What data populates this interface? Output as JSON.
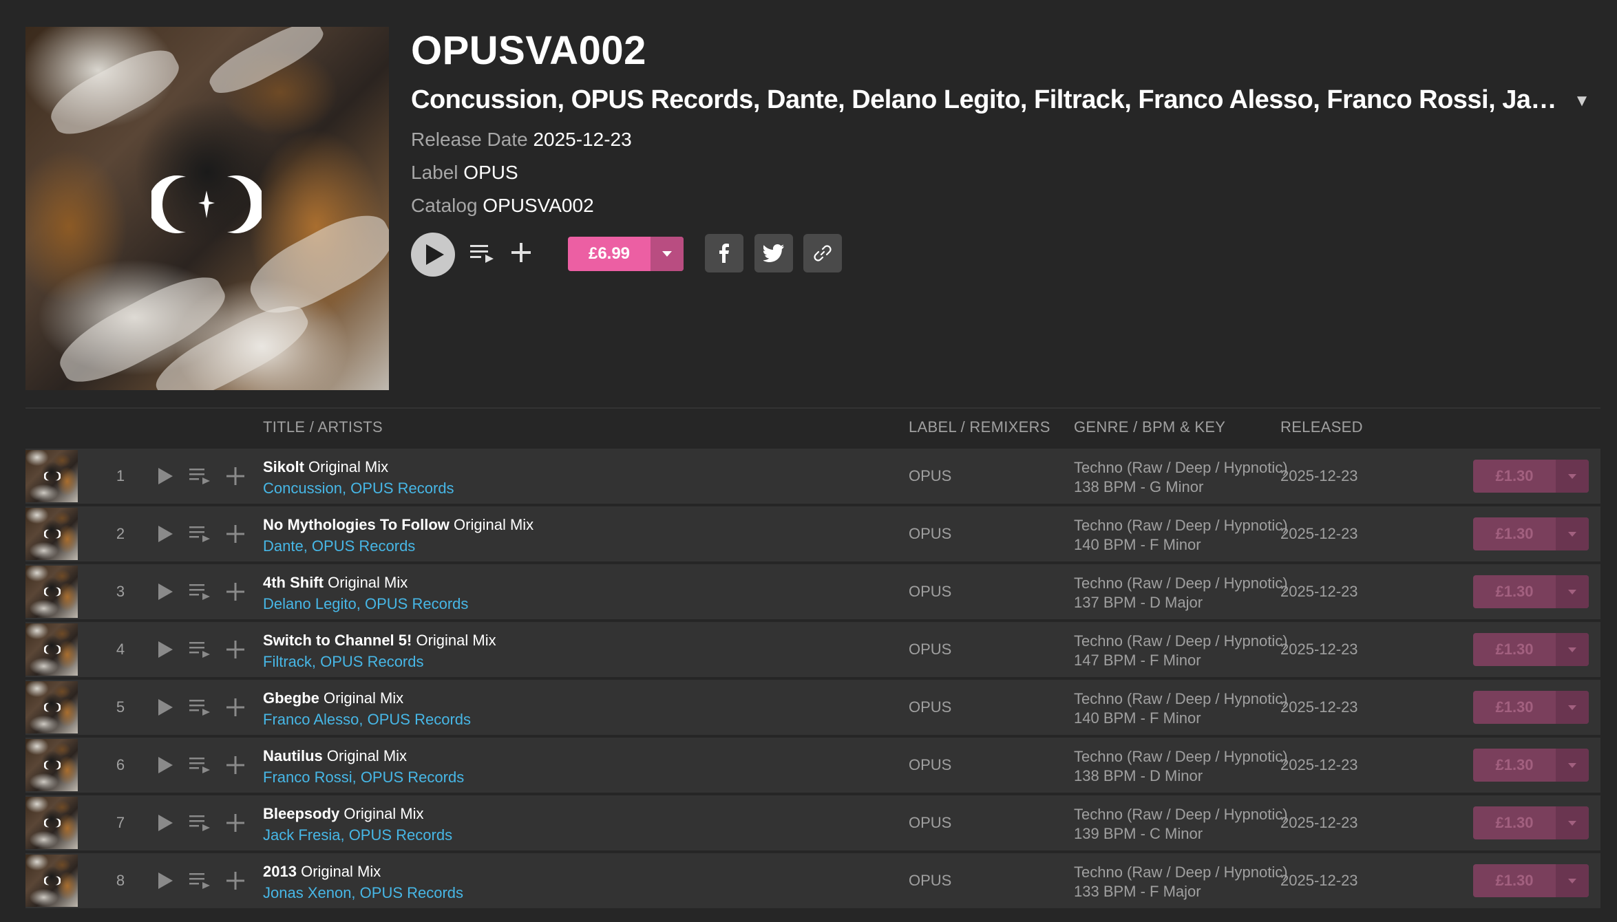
{
  "release": {
    "title": "OPUSVA002",
    "artists": "Concussion, OPUS Records, Dante, Delano Legito, Filtrack, Franco Alesso, Franco Rossi, Jack ...",
    "release_date_key": "Release Date",
    "release_date": "2025-12-23",
    "label_key": "Label",
    "label": "OPUS",
    "catalog_key": "Catalog",
    "catalog": "OPUSVA002",
    "price": "£6.99"
  },
  "colors": {
    "background": "#262626",
    "row_background": "#333333",
    "price_accent": "#ec5fa3",
    "artist_link": "#47b7e6",
    "muted_text": "#a0a0a0"
  },
  "icons": {
    "play": "play-icon",
    "queue": "add-to-queue-icon",
    "add": "plus-icon",
    "dropdown": "chevron-down-icon",
    "facebook": "facebook-icon",
    "twitter": "twitter-icon",
    "link": "link-icon"
  },
  "table": {
    "headers": {
      "title": "TITLE / ARTISTS",
      "label": "LABEL / REMIXERS",
      "genre": "GENRE / BPM & KEY",
      "released": "RELEASED"
    },
    "rows": [
      {
        "num": "1",
        "name": "Sikolt",
        "mix": "Original Mix",
        "artists": "Concussion, OPUS Records",
        "label": "OPUS",
        "genre": "Techno (Raw / Deep / Hypnotic)",
        "bpm_key": "138 BPM - G Minor",
        "released": "2025-12-23",
        "price": "£1.30"
      },
      {
        "num": "2",
        "name": "No Mythologies To Follow",
        "mix": "Original Mix",
        "artists": "Dante, OPUS Records",
        "label": "OPUS",
        "genre": "Techno (Raw / Deep / Hypnotic)",
        "bpm_key": "140 BPM - F Minor",
        "released": "2025-12-23",
        "price": "£1.30"
      },
      {
        "num": "3",
        "name": "4th Shift",
        "mix": "Original Mix",
        "artists": "Delano Legito, OPUS Records",
        "label": "OPUS",
        "genre": "Techno (Raw / Deep / Hypnotic)",
        "bpm_key": "137 BPM - D Major",
        "released": "2025-12-23",
        "price": "£1.30"
      },
      {
        "num": "4",
        "name": "Switch to Channel 5!",
        "mix": "Original Mix",
        "artists": "Filtrack, OPUS Records",
        "label": "OPUS",
        "genre": "Techno (Raw / Deep / Hypnotic)",
        "bpm_key": "147 BPM - F Minor",
        "released": "2025-12-23",
        "price": "£1.30"
      },
      {
        "num": "5",
        "name": "Gbegbe",
        "mix": "Original Mix",
        "artists": "Franco Alesso, OPUS Records",
        "label": "OPUS",
        "genre": "Techno (Raw / Deep / Hypnotic)",
        "bpm_key": "140 BPM - F Minor",
        "released": "2025-12-23",
        "price": "£1.30"
      },
      {
        "num": "6",
        "name": "Nautilus",
        "mix": "Original Mix",
        "artists": "Franco Rossi, OPUS Records",
        "label": "OPUS",
        "genre": "Techno (Raw / Deep / Hypnotic)",
        "bpm_key": "138 BPM - D Minor",
        "released": "2025-12-23",
        "price": "£1.30"
      },
      {
        "num": "7",
        "name": "Bleepsody",
        "mix": "Original Mix",
        "artists": "Jack Fresia, OPUS Records",
        "label": "OPUS",
        "genre": "Techno (Raw / Deep / Hypnotic)",
        "bpm_key": "139 BPM - C Minor",
        "released": "2025-12-23",
        "price": "£1.30"
      },
      {
        "num": "8",
        "name": "2013",
        "mix": "Original Mix",
        "artists": "Jonas Xenon, OPUS Records",
        "label": "OPUS",
        "genre": "Techno (Raw / Deep / Hypnotic)",
        "bpm_key": "133 BPM - F Major",
        "released": "2025-12-23",
        "price": "£1.30"
      }
    ]
  }
}
